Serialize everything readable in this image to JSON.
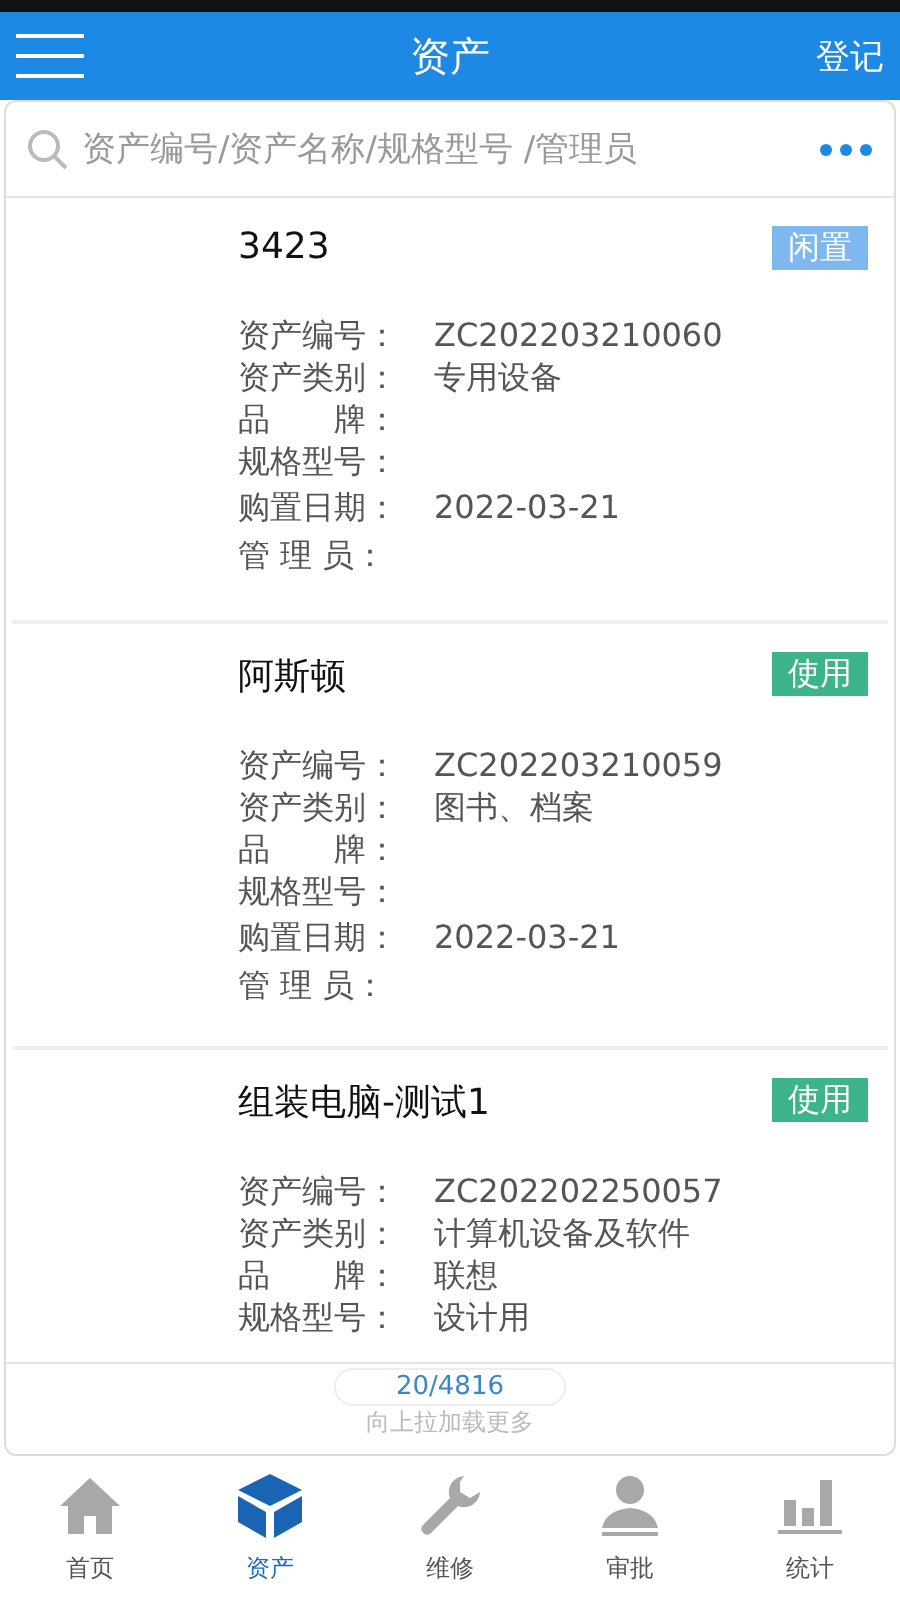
{
  "header": {
    "title": "资产",
    "action": "登记"
  },
  "search": {
    "placeholder": "资产编号/资产名称/规格型号 /管理员"
  },
  "assets": [
    {
      "name": "3423",
      "status": "闲置",
      "color": "#7fb8ef",
      "fields": [
        {
          "label": "资产编号：",
          "value": "ZC202203210060"
        },
        {
          "label": "资产类别：",
          "value": "专用设备"
        },
        {
          "label": "品　　牌："
        },
        {
          "label": "规格型号："
        },
        {
          "label": "购置日期：",
          "value": "2022-03-21"
        },
        {
          "label": "管 理 员："
        }
      ]
    },
    {
      "name": "阿斯顿",
      "status": "使用",
      "color": "#3db48a",
      "fields": [
        {
          "label": "资产编号：",
          "value": "ZC202203210059"
        },
        {
          "label": "资产类别：",
          "value": "图书、档案"
        },
        {
          "label": "品　　牌："
        },
        {
          "label": "规格型号："
        },
        {
          "label": "购置日期：",
          "value": "2022-03-21"
        },
        {
          "label": "管 理 员："
        }
      ]
    },
    {
      "name": "组装电脑-测试1",
      "status": "使用",
      "color": "#3db48a",
      "fields": [
        {
          "label": "资产编号：",
          "value": "ZC202202250057"
        },
        {
          "label": "资产类别：",
          "value": "计算机设备及软件"
        },
        {
          "label": "品　　牌：",
          "value": "联想"
        },
        {
          "label": "规格型号：",
          "value": "设计用"
        }
      ]
    }
  ],
  "pager": {
    "count": "20/4816",
    "hint": "向上拉加载更多"
  },
  "tabs": [
    {
      "label": "首页",
      "kind": "home",
      "selected": false
    },
    {
      "label": "资产",
      "kind": "box",
      "selected": true
    },
    {
      "label": "维修",
      "kind": "wrench",
      "selected": false
    },
    {
      "label": "审批",
      "kind": "person",
      "selected": false
    },
    {
      "label": "统计",
      "kind": "chart",
      "selected": false
    }
  ]
}
